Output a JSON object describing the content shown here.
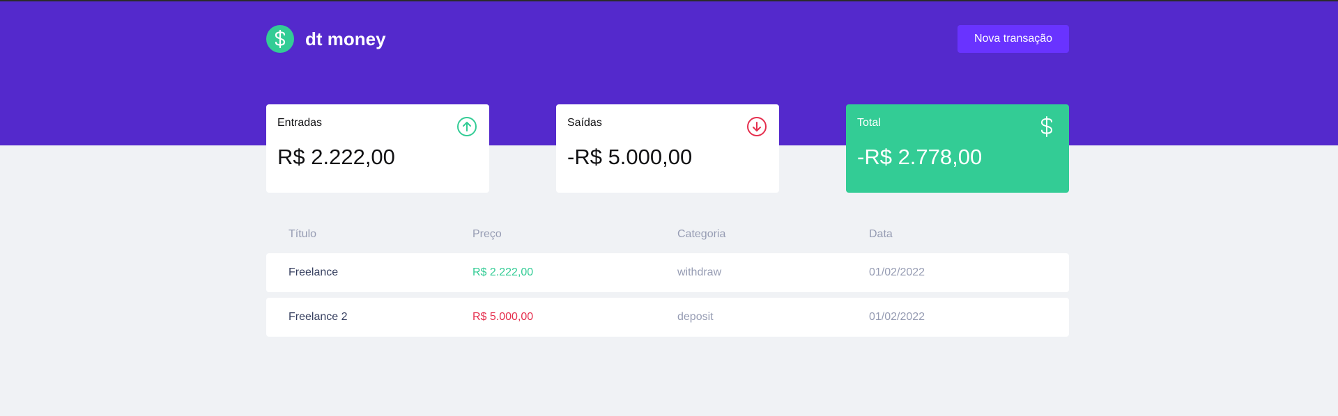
{
  "app": {
    "title": "dt money",
    "logo_icon": "dollar-icon"
  },
  "header": {
    "new_transaction_label": "Nova transação"
  },
  "summary": {
    "income": {
      "label": "Entradas",
      "value": "R$ 2.222,00",
      "icon": "arrow-up-circle-icon",
      "color": "#33cc95"
    },
    "outcome": {
      "label": "Saídas",
      "value": "-R$ 5.000,00",
      "icon": "arrow-down-circle-icon",
      "color": "#e52e4d"
    },
    "total": {
      "label": "Total",
      "value": "-R$ 2.778,00",
      "icon": "dollar-icon",
      "color": "#33cc95"
    }
  },
  "table": {
    "headers": [
      "Título",
      "Preço",
      "Categoria",
      "Data"
    ],
    "rows": [
      {
        "title": "Freelance",
        "price": "R$ 2.222,00",
        "category": "withdraw",
        "date": "01/02/2022",
        "type": "deposit"
      },
      {
        "title": "Freelance 2",
        "price": "R$ 5.000,00",
        "category": "deposit",
        "date": "01/02/2022",
        "type": "withdraw"
      }
    ]
  },
  "colors": {
    "brand": "#5429cc",
    "button": "#6933ff",
    "green": "#33cc95",
    "red": "#e52e4d",
    "background": "#f0f2f5"
  }
}
